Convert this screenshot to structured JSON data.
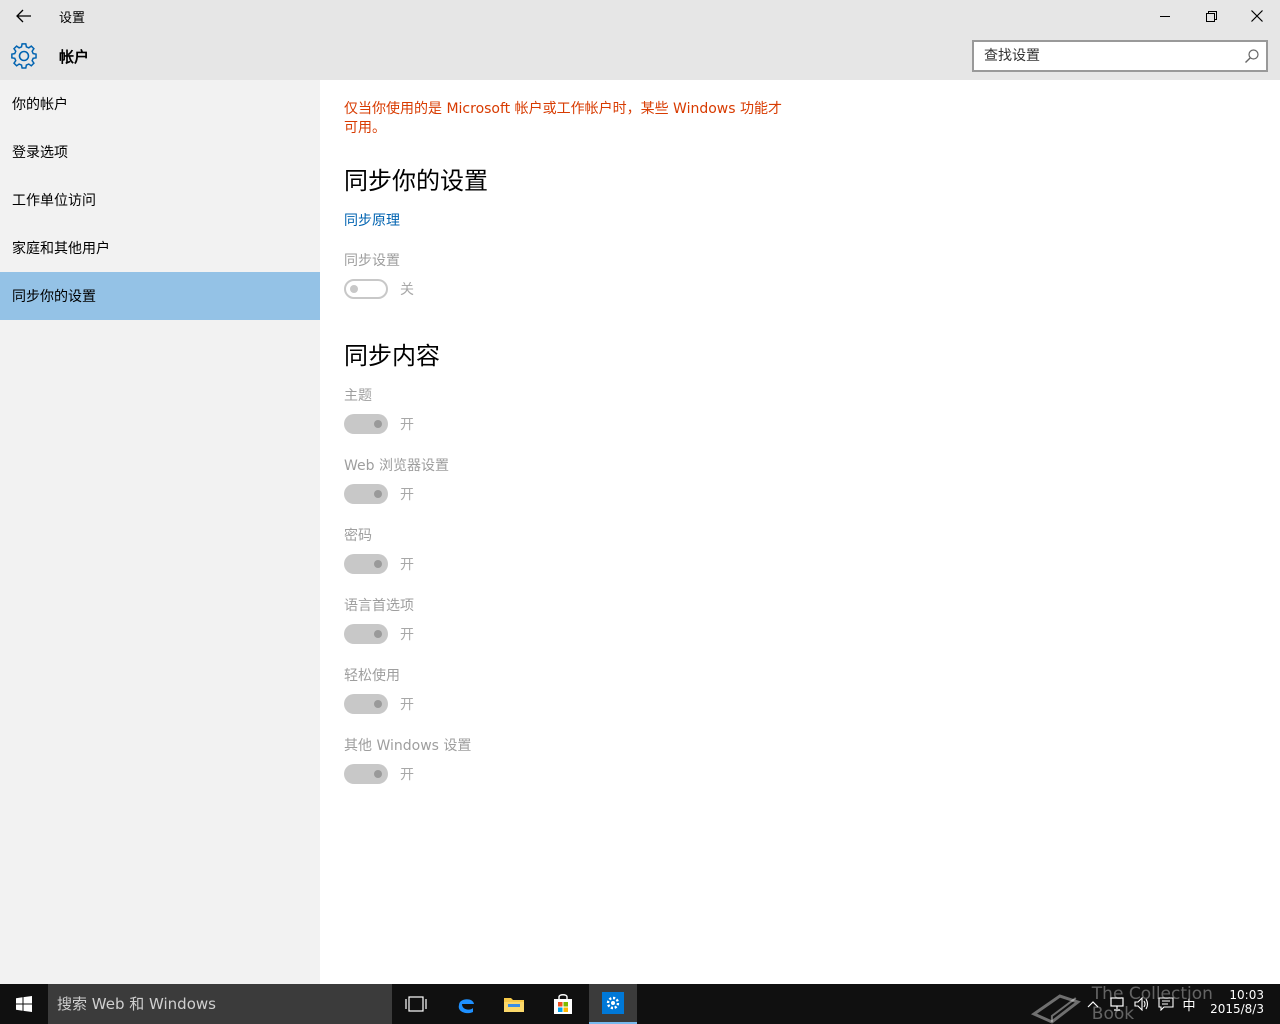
{
  "titlebar": {
    "title": "设置"
  },
  "header": {
    "section_title": "帐户",
    "search_placeholder": "查找设置"
  },
  "sidebar": {
    "items": [
      {
        "label": "你的帐户",
        "selected": false
      },
      {
        "label": "登录选项",
        "selected": false
      },
      {
        "label": "工作单位访问",
        "selected": false
      },
      {
        "label": "家庭和其他用户",
        "selected": false
      },
      {
        "label": "同步你的设置",
        "selected": true
      }
    ]
  },
  "main": {
    "warning": "仅当你使用的是 Microsoft 帐户或工作帐户时，某些 Windows 功能才可用。",
    "sync_heading": "同步你的设置",
    "how_sync_link": "同步原理",
    "sync_settings": {
      "label": "同步设置",
      "state": "关"
    },
    "content_heading": "同步内容",
    "content_items": [
      {
        "label": "主题",
        "state": "开"
      },
      {
        "label": "Web 浏览器设置",
        "state": "开"
      },
      {
        "label": "密码",
        "state": "开"
      },
      {
        "label": "语言首选项",
        "state": "开"
      },
      {
        "label": "轻松使用",
        "state": "开"
      },
      {
        "label": "其他 Windows 设置",
        "state": "开"
      }
    ]
  },
  "taskbar": {
    "search_placeholder": "搜索 Web 和 Windows",
    "ime": "中",
    "time": "10:03",
    "date": "2015/8/3",
    "watermark": "The Collection Book"
  },
  "colors": {
    "accent": "#0063b1",
    "selected_nav": "#94c2e6",
    "warning": "#d83b01",
    "titlebar": "#e6e6e6",
    "sidebar": "#f2f2f2",
    "taskbar": "#101010"
  }
}
